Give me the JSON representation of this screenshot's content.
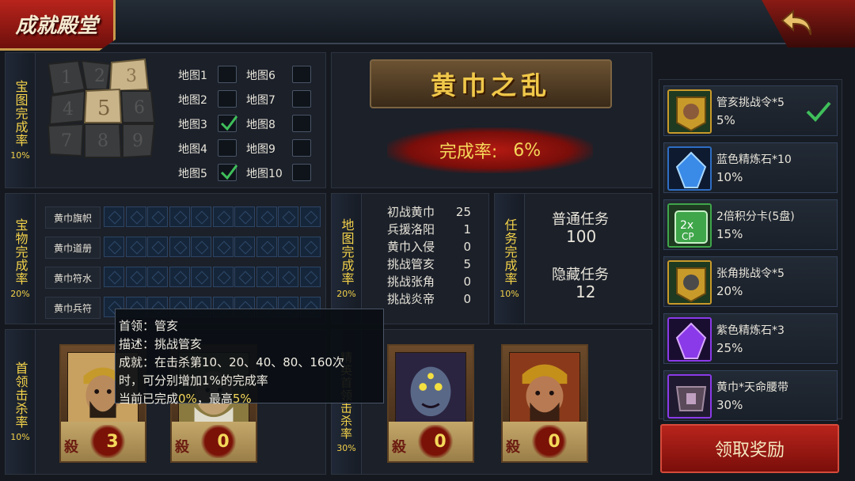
{
  "header": {
    "title": "成就殿堂"
  },
  "map_panel": {
    "label": "宝图完成率",
    "percent": "10%",
    "maps": [
      {
        "label": "地图1",
        "checked": false
      },
      {
        "label": "地图2",
        "checked": false
      },
      {
        "label": "地图3",
        "checked": true
      },
      {
        "label": "地图4",
        "checked": false
      },
      {
        "label": "地图5",
        "checked": true
      },
      {
        "label": "地图6",
        "checked": false
      },
      {
        "label": "地图7",
        "checked": false
      },
      {
        "label": "地图8",
        "checked": false
      },
      {
        "label": "地图9",
        "checked": false
      },
      {
        "label": "地图10",
        "checked": false
      }
    ]
  },
  "event": {
    "title": "黄巾之乱",
    "rate_label": "完成率:",
    "rate_value": "6%"
  },
  "treasure_panel": {
    "label": "宝物完成率",
    "percent": "20%",
    "items": [
      "黄巾旗帜",
      "黄巾道册",
      "黄巾符水",
      "黄巾兵符"
    ]
  },
  "map_stats_panel": {
    "label": "地图完成率",
    "percent": "20%",
    "stats": [
      {
        "name": "初战黄巾",
        "value": "25"
      },
      {
        "name": "兵援洛阳",
        "value": "1"
      },
      {
        "name": "黄巾入侵",
        "value": "0"
      },
      {
        "name": "挑战管亥",
        "value": "5"
      },
      {
        "name": "挑战张角",
        "value": "0"
      },
      {
        "name": "挑战炎帝",
        "value": "0"
      }
    ]
  },
  "task_panel": {
    "label": "任务完成率",
    "percent": "10%",
    "normal_label": "普通任务",
    "normal_value": "100",
    "hidden_label": "隐藏任务",
    "hidden_value": "12"
  },
  "boss_panel": {
    "label": "首领击杀率",
    "percent": "10%",
    "kills": [
      "3",
      "0"
    ]
  },
  "elite_panel": {
    "label": "精英首领击杀率",
    "percent": "30%",
    "kills": [
      "0",
      "0"
    ]
  },
  "tooltip": {
    "line1": "首领：管亥",
    "line2": "描述：挑战管亥",
    "line3": "成就：在击杀第10、20、40、80、160次",
    "line4": "时，可分别增加1%的完成率",
    "line5_prefix": "当前已完成",
    "line5_current": "0%",
    "line5_sep": "，最高",
    "line5_max": "5%"
  },
  "rewards": [
    {
      "name": "管亥挑战令*5",
      "percent": "5%",
      "icon": "guanhai-token-icon",
      "done": true
    },
    {
      "name": "蓝色精炼石*10",
      "percent": "10%",
      "icon": "blue-gem-icon",
      "done": false
    },
    {
      "name": "2倍积分卡(5盘)",
      "percent": "15%",
      "icon": "double-points-card-icon",
      "done": false
    },
    {
      "name": "张角挑战令*5",
      "percent": "20%",
      "icon": "zhangjiao-token-icon",
      "done": false
    },
    {
      "name": "紫色精炼石*3",
      "percent": "25%",
      "icon": "purple-gem-icon",
      "done": false
    },
    {
      "name": "黄巾*天命腰带",
      "percent": "30%",
      "icon": "belt-icon",
      "done": false
    }
  ],
  "claim_button": "领取奖励",
  "colors": {
    "accent_gold": "#f3d24a",
    "accent_red": "#b8241c",
    "check_green": "#3fbf5a"
  }
}
